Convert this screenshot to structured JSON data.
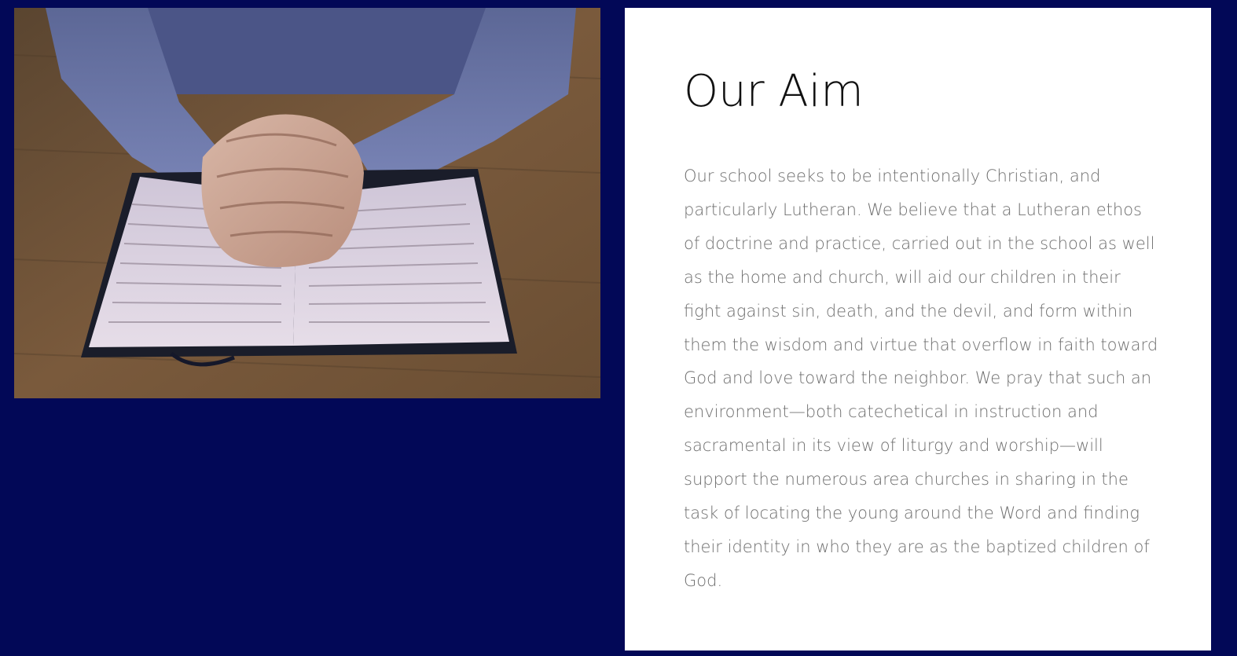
{
  "aim": {
    "title": "Our Aim",
    "body": "Our school seeks to be intentionally Christian, and particularly Lutheran. We believe that a Lutheran ethos of doctrine and practice, carried out in the school as well as the home and church, will aid our children in their fight against sin, death, and the devil, and form within them the wisdom and virtue that overflow in faith toward God and love toward the neighbor. We pray that such an environment—both catechetical in instruction and sacramental in its view of liturgy and worship—will support the numerous area churches in sharing in the task of locating the young around the Word and finding their identity in who they are as the baptized children of God."
  },
  "photo": {
    "description_icon": "praying-hands-on-bible-photo"
  },
  "colors": {
    "page_background": "#020857",
    "card_background": "#ffffff",
    "heading": "#111111",
    "body_text": "#6f6f6f"
  }
}
